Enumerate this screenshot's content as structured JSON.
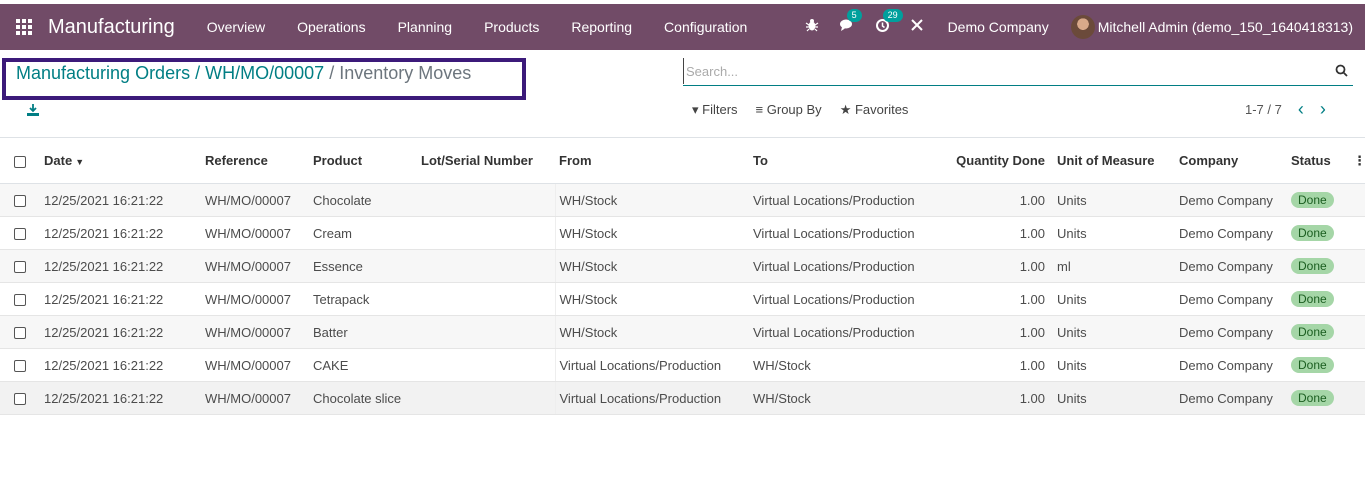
{
  "navbar": {
    "brand": "Manufacturing",
    "menu": [
      "Overview",
      "Operations",
      "Planning",
      "Products",
      "Reporting",
      "Configuration"
    ],
    "messages_count": "5",
    "activities_count": "29",
    "company": "Demo Company",
    "user": "Mitchell Admin (demo_150_1640418313)"
  },
  "breadcrumb": {
    "items": [
      "Manufacturing Orders",
      "WH/MO/00007"
    ],
    "current": "Inventory Moves",
    "separator": "/"
  },
  "search": {
    "placeholder": "Search..."
  },
  "filters": {
    "filters": "Filters",
    "group_by": "Group By",
    "favorites": "Favorites"
  },
  "pager": {
    "range": "1-7 / 7"
  },
  "colors": {
    "navbar": "#714b67",
    "accent": "#017e84",
    "done_badge": "#a5d6a7",
    "highlight_box": "#3c1a7a"
  },
  "table": {
    "headers": [
      "Date",
      "Reference",
      "Product",
      "Lot/Serial Number",
      "From",
      "To",
      "Quantity Done",
      "Unit of Measure",
      "Company",
      "Status"
    ],
    "rows": [
      [
        "12/25/2021 16:21:22",
        "WH/MO/00007",
        "Chocolate",
        "",
        "WH/Stock",
        "Virtual Locations/Production",
        "1.00",
        "Units",
        "Demo Company",
        "Done"
      ],
      [
        "12/25/2021 16:21:22",
        "WH/MO/00007",
        "Cream",
        "",
        "WH/Stock",
        "Virtual Locations/Production",
        "1.00",
        "Units",
        "Demo Company",
        "Done"
      ],
      [
        "12/25/2021 16:21:22",
        "WH/MO/00007",
        "Essence",
        "",
        "WH/Stock",
        "Virtual Locations/Production",
        "1.00",
        "ml",
        "Demo Company",
        "Done"
      ],
      [
        "12/25/2021 16:21:22",
        "WH/MO/00007",
        "Tetrapack",
        "",
        "WH/Stock",
        "Virtual Locations/Production",
        "1.00",
        "Units",
        "Demo Company",
        "Done"
      ],
      [
        "12/25/2021 16:21:22",
        "WH/MO/00007",
        "Batter",
        "",
        "WH/Stock",
        "Virtual Locations/Production",
        "1.00",
        "Units",
        "Demo Company",
        "Done"
      ],
      [
        "12/25/2021 16:21:22",
        "WH/MO/00007",
        "CAKE",
        "",
        "Virtual Locations/Production",
        "WH/Stock",
        "1.00",
        "Units",
        "Demo Company",
        "Done"
      ],
      [
        "12/25/2021 16:21:22",
        "WH/MO/00007",
        "Chocolate slice",
        "",
        "Virtual Locations/Production",
        "WH/Stock",
        "1.00",
        "Units",
        "Demo Company",
        "Done"
      ]
    ]
  }
}
